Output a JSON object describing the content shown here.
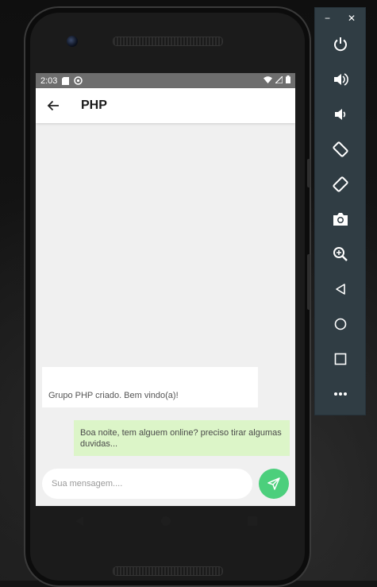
{
  "status_bar": {
    "time": "2:03"
  },
  "app_bar": {
    "title": "PHP"
  },
  "messages": [
    {
      "type": "incoming",
      "text": "Grupo PHP criado. Bem vindo(a)!"
    },
    {
      "type": "outgoing",
      "text": "Boa noite, tem alguem online? preciso tirar algumas duvidas..."
    }
  ],
  "composer": {
    "placeholder": "Sua mensagem...."
  },
  "toolbar": {
    "minimize_label": "−",
    "close_label": "✕",
    "items": [
      "power-icon",
      "volume-up-icon",
      "volume-down-icon",
      "rotate-left-icon",
      "rotate-right-icon",
      "camera-icon",
      "zoom-icon",
      "back-icon",
      "home-icon",
      "overview-icon",
      "more-icon"
    ]
  },
  "colors": {
    "accent_send": "#4ccf7c",
    "outgoing_bubble": "#dcf5c8",
    "toolbar_bg": "#303d44",
    "status_bar": "#6e6e6e"
  }
}
